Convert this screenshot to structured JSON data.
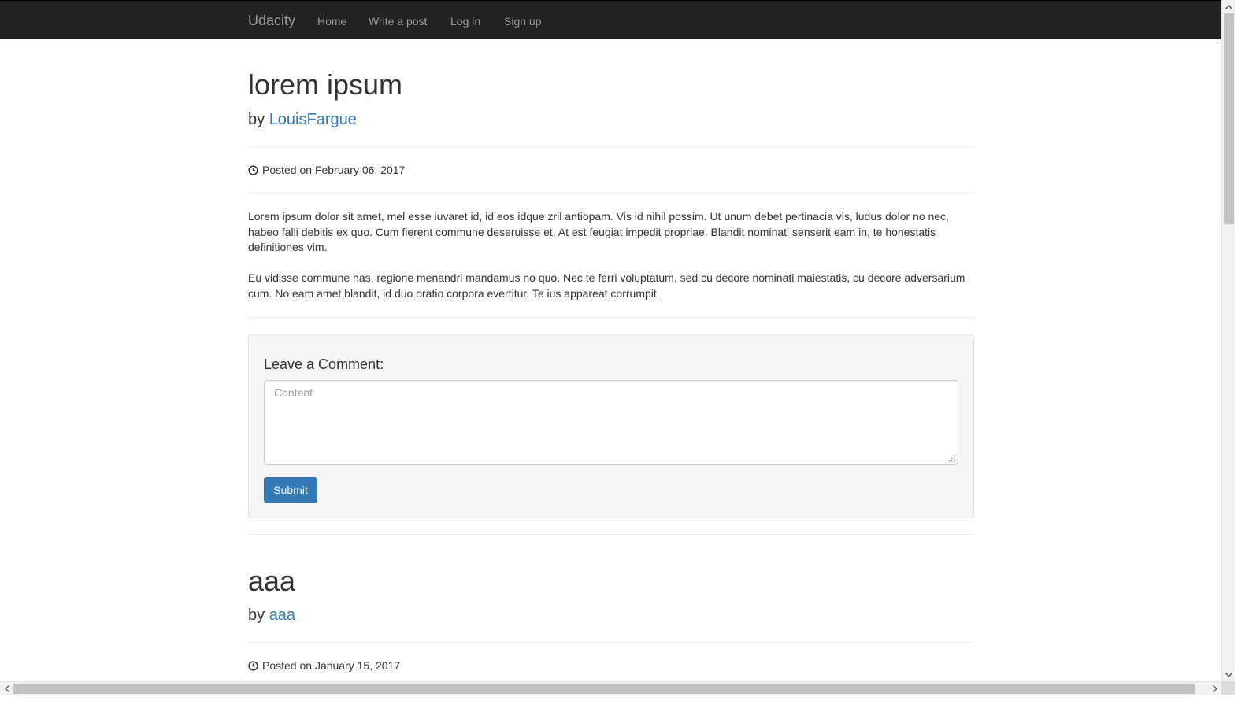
{
  "navbar": {
    "brand": "Udacity",
    "links": [
      "Home",
      "Write a post",
      "Log in",
      "Sign up"
    ]
  },
  "posts": [
    {
      "title": "lorem ipsum",
      "by_prefix": "by ",
      "author": "LouisFargue",
      "posted": "Posted on February 06, 2017",
      "paragraphs": [
        "Lorem ipsum dolor sit amet, mel esse iuvaret id, id eos idque zril antiopam. Vis id nihil possim. Ut unum debet pertinacia vis, ludus dolor no nec, habeo falli debitis ex quo. Cum fierent commune deseruisse et. At est feugiat impedit propriae. Blandit nominati senserit eam in, te honestatis definitiones vim.",
        "Eu vidisse commune has, regione menandri mandamus no quo. Nec te ferri voluptatum, sed cu decore nominati maiestatis, cu decore adversarium cum. No eam amet blandit, id duo oratio corpora evertitur. Te ius appareat corrumpit."
      ]
    },
    {
      "title": "aaa",
      "by_prefix": "by ",
      "author": "aaa",
      "posted": "Posted on January 15, 2017"
    }
  ],
  "comment_form": {
    "heading": "Leave a Comment:",
    "placeholder": "Content",
    "submit_label": "Submit"
  },
  "colors": {
    "navbar_bg": "#222222",
    "nav_text": "#9d9d9d",
    "link": "#337ab7",
    "button_bg": "#337ab7",
    "well_bg": "#f5f5f5"
  }
}
